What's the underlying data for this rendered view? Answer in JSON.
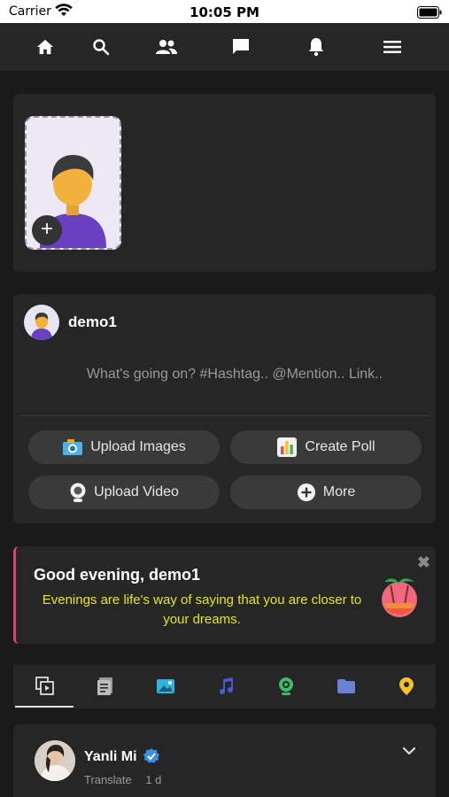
{
  "status_bar": {
    "carrier": "Carrier",
    "time": "10:05 PM"
  },
  "nav": {
    "icons": [
      "home-icon",
      "search-icon",
      "friends-icon",
      "messages-icon",
      "notifications-icon",
      "menu-icon"
    ]
  },
  "stories": {
    "add_icon": "+"
  },
  "composer": {
    "username": "demo1",
    "placeholder": "What's going on? #Hashtag.. @Mention.. Link..",
    "actions": {
      "upload_images": "Upload Images",
      "create_poll": "Create Poll",
      "upload_video": "Upload Video",
      "more": "More"
    }
  },
  "greeting": {
    "title": "Good evening, demo1",
    "message": "Evenings are life's way of saying that you are closer to your dreams.",
    "close": "✖"
  },
  "filters": {
    "tabs": [
      "all-posts-icon",
      "articles-icon",
      "photos-icon",
      "music-icon",
      "video-icon",
      "files-icon",
      "places-icon"
    ],
    "active": 0
  },
  "post": {
    "author": "Yanli Mi",
    "translate": "Translate",
    "time": "1 d"
  },
  "colors": {
    "accent_pink": "#d6456b",
    "greeting_text": "#e8e51a",
    "card_bg": "#262626",
    "page_bg": "#1a1a1a"
  }
}
